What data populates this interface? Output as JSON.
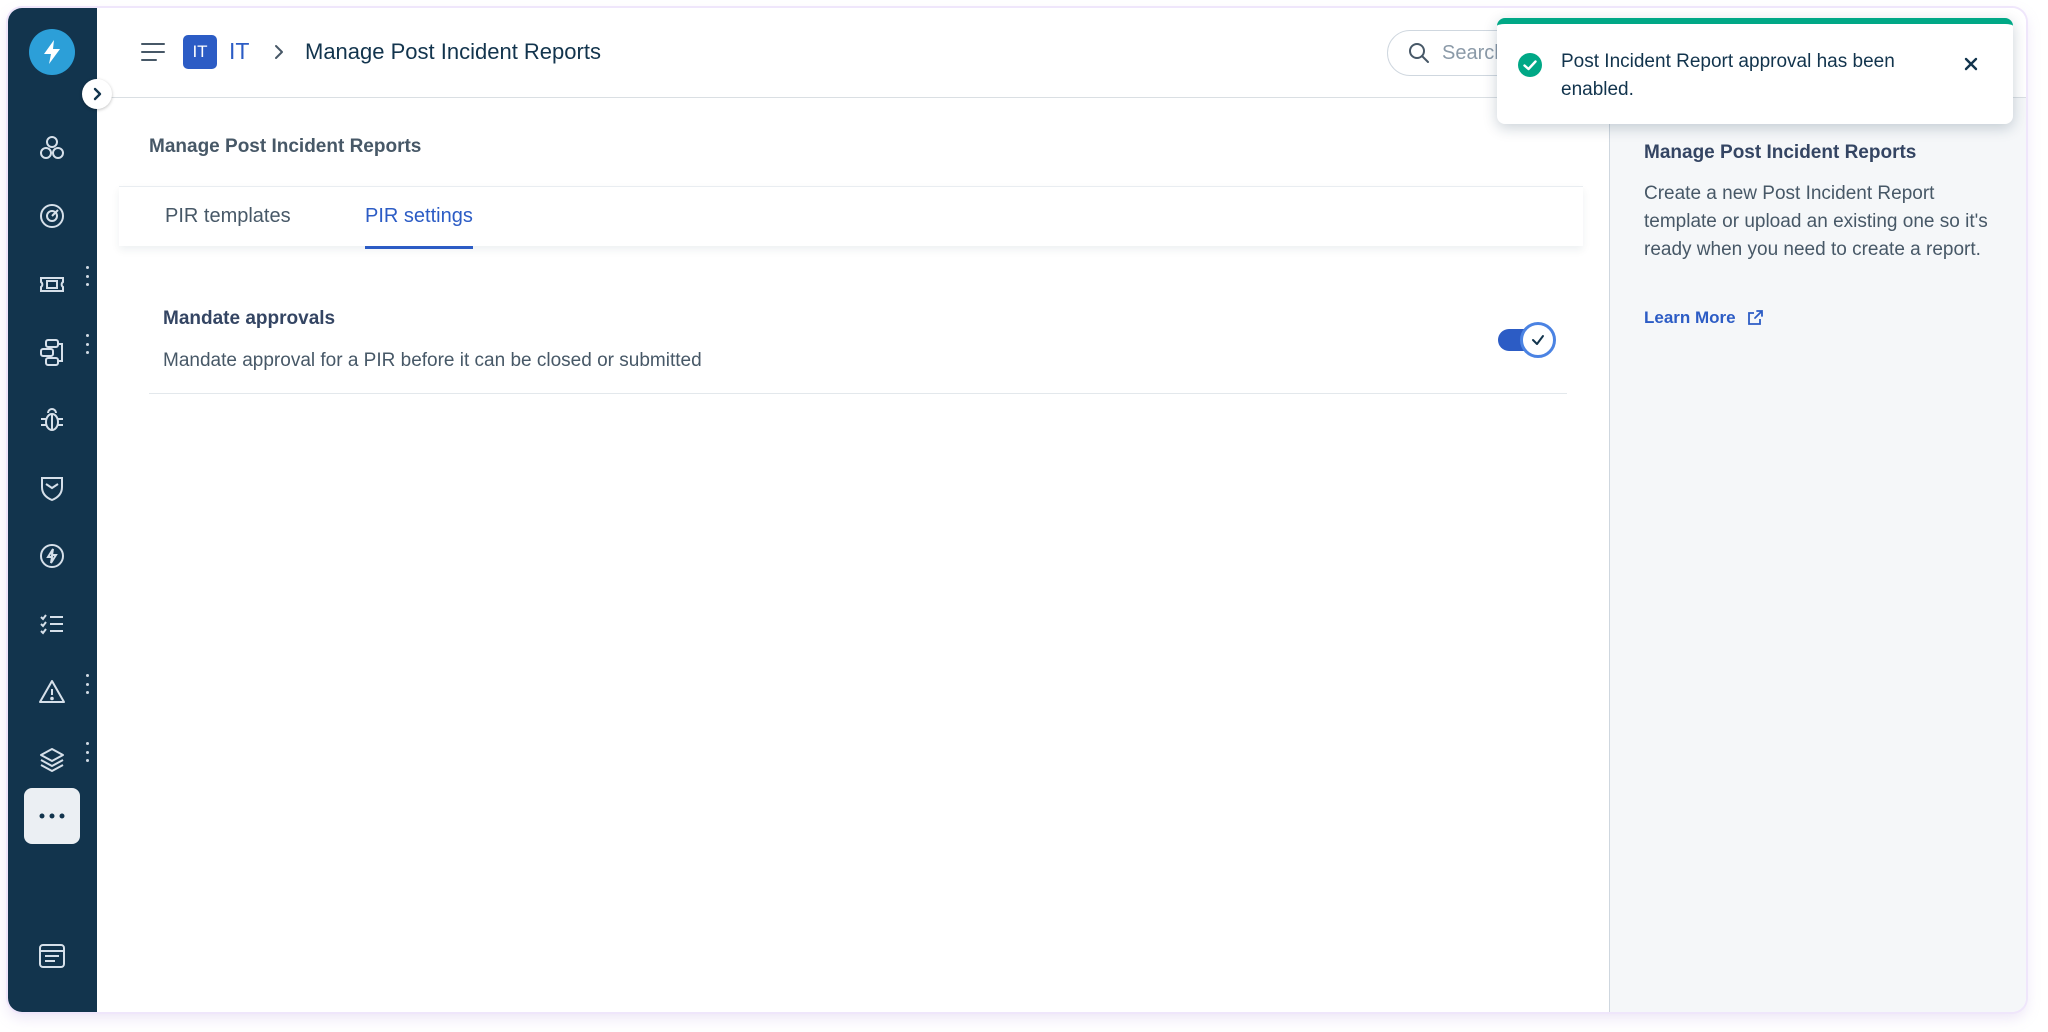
{
  "sidebar": {
    "logo_icon": "lightning-bolt-icon",
    "items": [
      {
        "icon": "admin-cluster-icon"
      },
      {
        "icon": "dashboard-gauge-icon"
      },
      {
        "icon": "ticket-icon"
      },
      {
        "icon": "workflow-icon"
      },
      {
        "icon": "bug-icon"
      },
      {
        "icon": "shield-icon"
      },
      {
        "icon": "bolt-circle-icon"
      },
      {
        "icon": "checklist-icon"
      },
      {
        "icon": "alert-triangle-icon"
      },
      {
        "icon": "layers-icon"
      },
      {
        "icon": "more-icon"
      },
      {
        "icon": "app-panel-icon"
      }
    ]
  },
  "header": {
    "workspace_badge": "IT",
    "workspace_name": "IT",
    "title": "Manage Post Incident Reports",
    "search_placeholder": "Search"
  },
  "main": {
    "title": "Manage Post Incident Reports",
    "tabs": [
      {
        "label": "PIR templates"
      },
      {
        "label": "PIR settings"
      }
    ],
    "setting": {
      "title": "Mandate approvals",
      "description": "Mandate approval for a PIR before it can be closed or submitted",
      "enabled": true
    }
  },
  "right_panel": {
    "title": "Manage Post Incident Reports",
    "body": "Create a new Post Incident Report template or upload an existing one so it's ready when you need to create a report.",
    "link": "Learn More"
  },
  "toast": {
    "message": "Post Incident Report approval has been enabled."
  },
  "colors": {
    "sidebar": "#12344d",
    "accent": "#2c5cc5",
    "success": "#00a886"
  }
}
